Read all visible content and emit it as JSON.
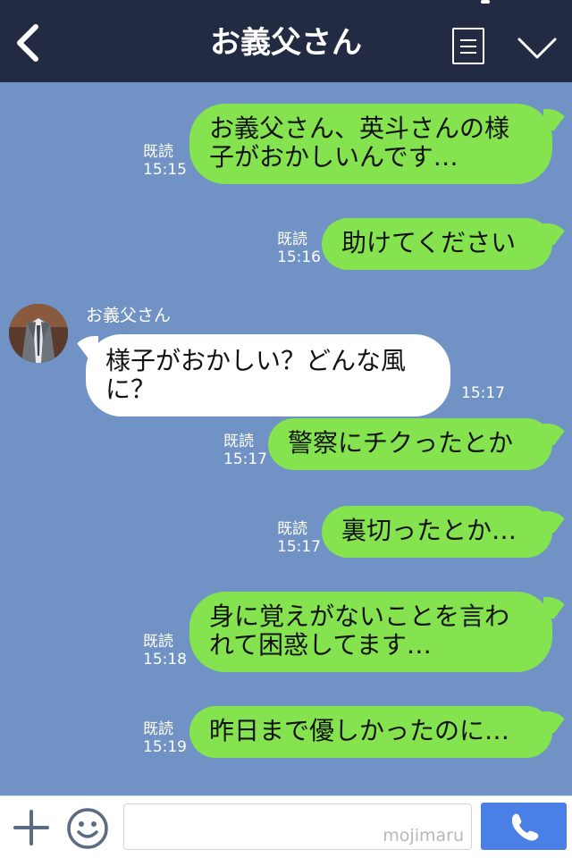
{
  "header": {
    "title": "お義父さん",
    "back_icon": "chevron-left-icon",
    "menu_icon": "menu-list-icon",
    "expand_icon": "chevron-down-icon"
  },
  "messages": [
    {
      "direction": "out",
      "text_lines": [
        "お義父さん、英斗さんの様",
        "子がおかしいんです…"
      ],
      "read": "既読",
      "time": "15:15"
    },
    {
      "direction": "out",
      "text_lines": [
        "助けてください"
      ],
      "read": "既読",
      "time": "15:16"
    },
    {
      "direction": "in",
      "sender": "お義父さん",
      "text_lines": [
        "様子がおかしい？どんな風",
        "に？"
      ],
      "time": "15:17"
    },
    {
      "direction": "out",
      "text_lines": [
        "警察にチクったとか"
      ],
      "read": "既読",
      "time": "15:17"
    },
    {
      "direction": "out",
      "text_lines": [
        "裏切ったとか…"
      ],
      "read": "既読",
      "time": "15:17"
    },
    {
      "direction": "out",
      "text_lines": [
        "身に覚えがないことを言わ",
        "れて困惑してます…"
      ],
      "read": "既読",
      "time": "15:18"
    },
    {
      "direction": "out",
      "text_lines": [
        "昨日まで優しかったのに…"
      ],
      "read": "既読",
      "time": "15:19"
    }
  ],
  "composer": {
    "plus_icon": "plus-icon",
    "emoji_icon": "smiley-icon",
    "input_value": "",
    "watermark": "mojimaru",
    "call_icon": "phone-icon"
  },
  "colors": {
    "header_bg": "#232b43",
    "chat_bg": "#7192c5",
    "outgoing_bubble": "#84e34e",
    "incoming_bubble": "#ffffff",
    "call_button": "#4a7fe6"
  }
}
